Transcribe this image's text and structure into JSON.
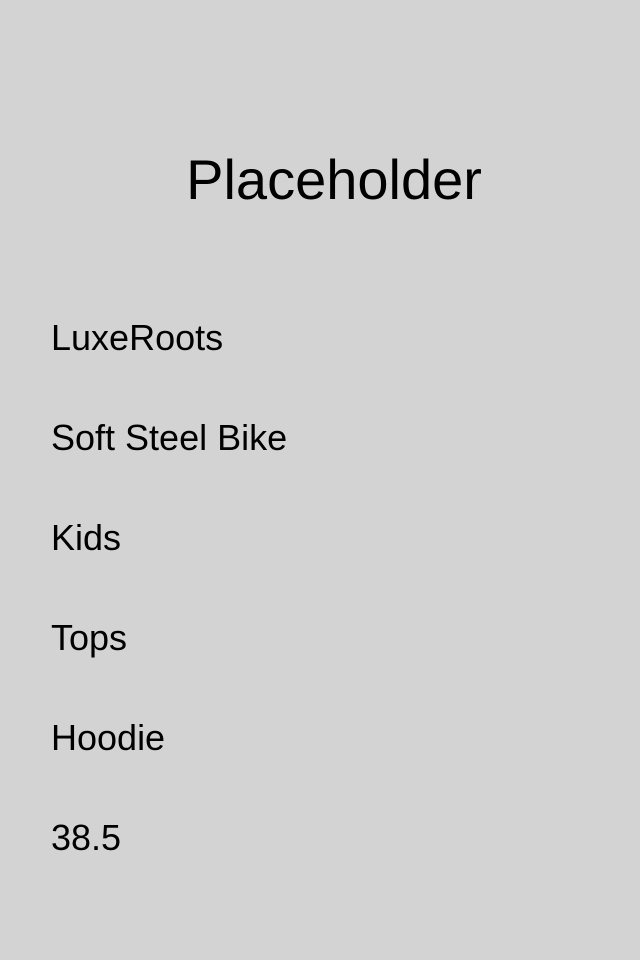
{
  "product": {
    "image_placeholder": "Placeholder",
    "brand": "LuxeRoots",
    "name": "Soft Steel Bike",
    "audience": "Kids",
    "category": "Tops",
    "type": "Hoodie",
    "price": "38.5"
  }
}
